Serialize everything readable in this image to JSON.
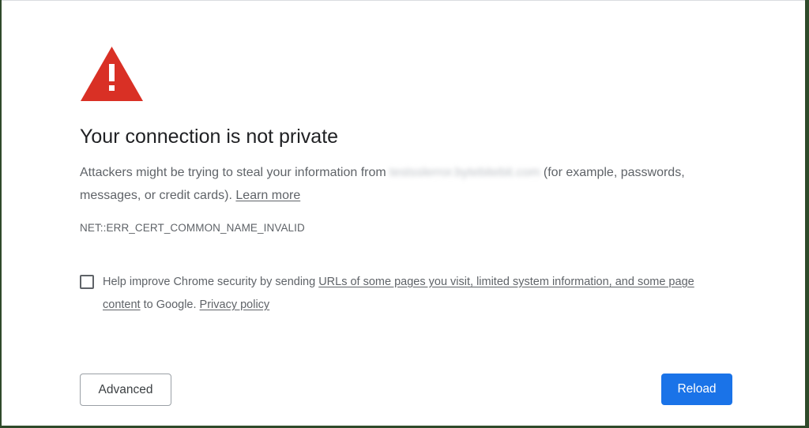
{
  "page": {
    "title": "Your connection is not private",
    "intro_before_host": "Attackers might be trying to steal your information from ",
    "host": "testsslerror.bytebitebit.com",
    "intro_after_host": " (for example, passwords, messages, or credit cards). ",
    "learn_more": "Learn more",
    "error_code": "NET::ERR_CERT_COMMON_NAME_INVALID",
    "warning_icon": "warning-triangle-icon",
    "accent_color": "#d93025"
  },
  "optin": {
    "text_before": "Help improve Chrome security by sending ",
    "link": "URLs of some pages you visit, limited system information, and some page content",
    "text_after": " to Google. ",
    "privacy_link": "Privacy policy",
    "checked": false
  },
  "buttons": {
    "advanced": "Advanced",
    "reload": "Reload",
    "reload_color": "#1a73e8"
  }
}
